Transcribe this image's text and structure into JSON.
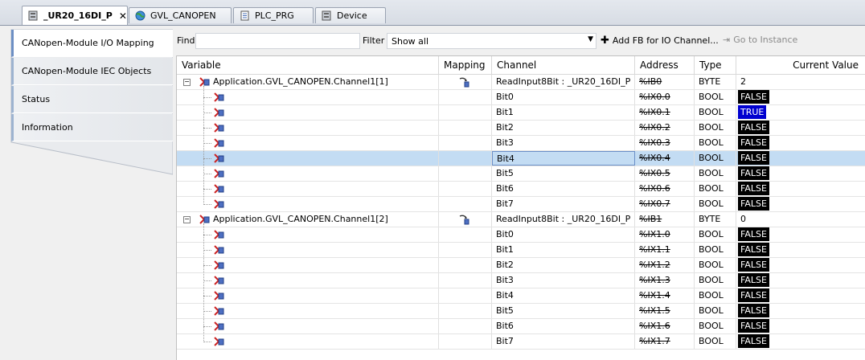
{
  "tabs": [
    {
      "label": "_UR20_16DI_P",
      "active": true,
      "icon": "device-module-icon",
      "closable": true
    },
    {
      "label": "GVL_CANOPEN",
      "active": false,
      "icon": "globe-icon"
    },
    {
      "label": "PLC_PRG",
      "active": false,
      "icon": "document-icon"
    },
    {
      "label": "Device",
      "active": false,
      "icon": "device-icon"
    }
  ],
  "left_tabs": [
    {
      "label": "CANopen-Module I/O Mapping",
      "active": true
    },
    {
      "label": "CANopen-Module IEC Objects",
      "active": false
    },
    {
      "label": "Status",
      "active": false
    },
    {
      "label": "Information",
      "active": false
    }
  ],
  "toolbar": {
    "find_label": "Find",
    "find_value": "",
    "filter_label": "Filter",
    "filter_value": "Show all",
    "add_fb_label": "Add FB for IO Channel...",
    "goto_label": "Go to Instance"
  },
  "columns": [
    "Variable",
    "Mapping",
    "Channel",
    "Address",
    "Type",
    "Current Value"
  ],
  "groups": [
    {
      "variable": "Application.GVL_CANOPEN.Channel1[1]",
      "channel": "ReadInput8Bit : _UR20_16DI_P",
      "address": "%IB0",
      "type": "BYTE",
      "value": "2",
      "bits": [
        {
          "channel": "Bit0",
          "address": "%IX0.0",
          "type": "BOOL",
          "value": "FALSE"
        },
        {
          "channel": "Bit1",
          "address": "%IX0.1",
          "type": "BOOL",
          "value": "TRUE"
        },
        {
          "channel": "Bit2",
          "address": "%IX0.2",
          "type": "BOOL",
          "value": "FALSE"
        },
        {
          "channel": "Bit3",
          "address": "%IX0.3",
          "type": "BOOL",
          "value": "FALSE"
        },
        {
          "channel": "Bit4",
          "address": "%IX0.4",
          "type": "BOOL",
          "value": "FALSE",
          "selected": true
        },
        {
          "channel": "Bit5",
          "address": "%IX0.5",
          "type": "BOOL",
          "value": "FALSE"
        },
        {
          "channel": "Bit6",
          "address": "%IX0.6",
          "type": "BOOL",
          "value": "FALSE"
        },
        {
          "channel": "Bit7",
          "address": "%IX0.7",
          "type": "BOOL",
          "value": "FALSE"
        }
      ]
    },
    {
      "variable": "Application.GVL_CANOPEN.Channel1[2]",
      "channel": "ReadInput8Bit : _UR20_16DI_P",
      "address": "%IB1",
      "type": "BYTE",
      "value": "0",
      "bits": [
        {
          "channel": "Bit0",
          "address": "%IX1.0",
          "type": "BOOL",
          "value": "FALSE"
        },
        {
          "channel": "Bit1",
          "address": "%IX1.1",
          "type": "BOOL",
          "value": "FALSE"
        },
        {
          "channel": "Bit2",
          "address": "%IX1.2",
          "type": "BOOL",
          "value": "FALSE"
        },
        {
          "channel": "Bit3",
          "address": "%IX1.3",
          "type": "BOOL",
          "value": "FALSE"
        },
        {
          "channel": "Bit4",
          "address": "%IX1.4",
          "type": "BOOL",
          "value": "FALSE"
        },
        {
          "channel": "Bit5",
          "address": "%IX1.5",
          "type": "BOOL",
          "value": "FALSE"
        },
        {
          "channel": "Bit6",
          "address": "%IX1.6",
          "type": "BOOL",
          "value": "FALSE"
        },
        {
          "channel": "Bit7",
          "address": "%IX1.7",
          "type": "BOOL",
          "value": "FALSE"
        }
      ]
    }
  ],
  "colors": {
    "false_bg": "#000000",
    "true_bg": "#0000d0",
    "selected_row": "#c3dcf3"
  }
}
